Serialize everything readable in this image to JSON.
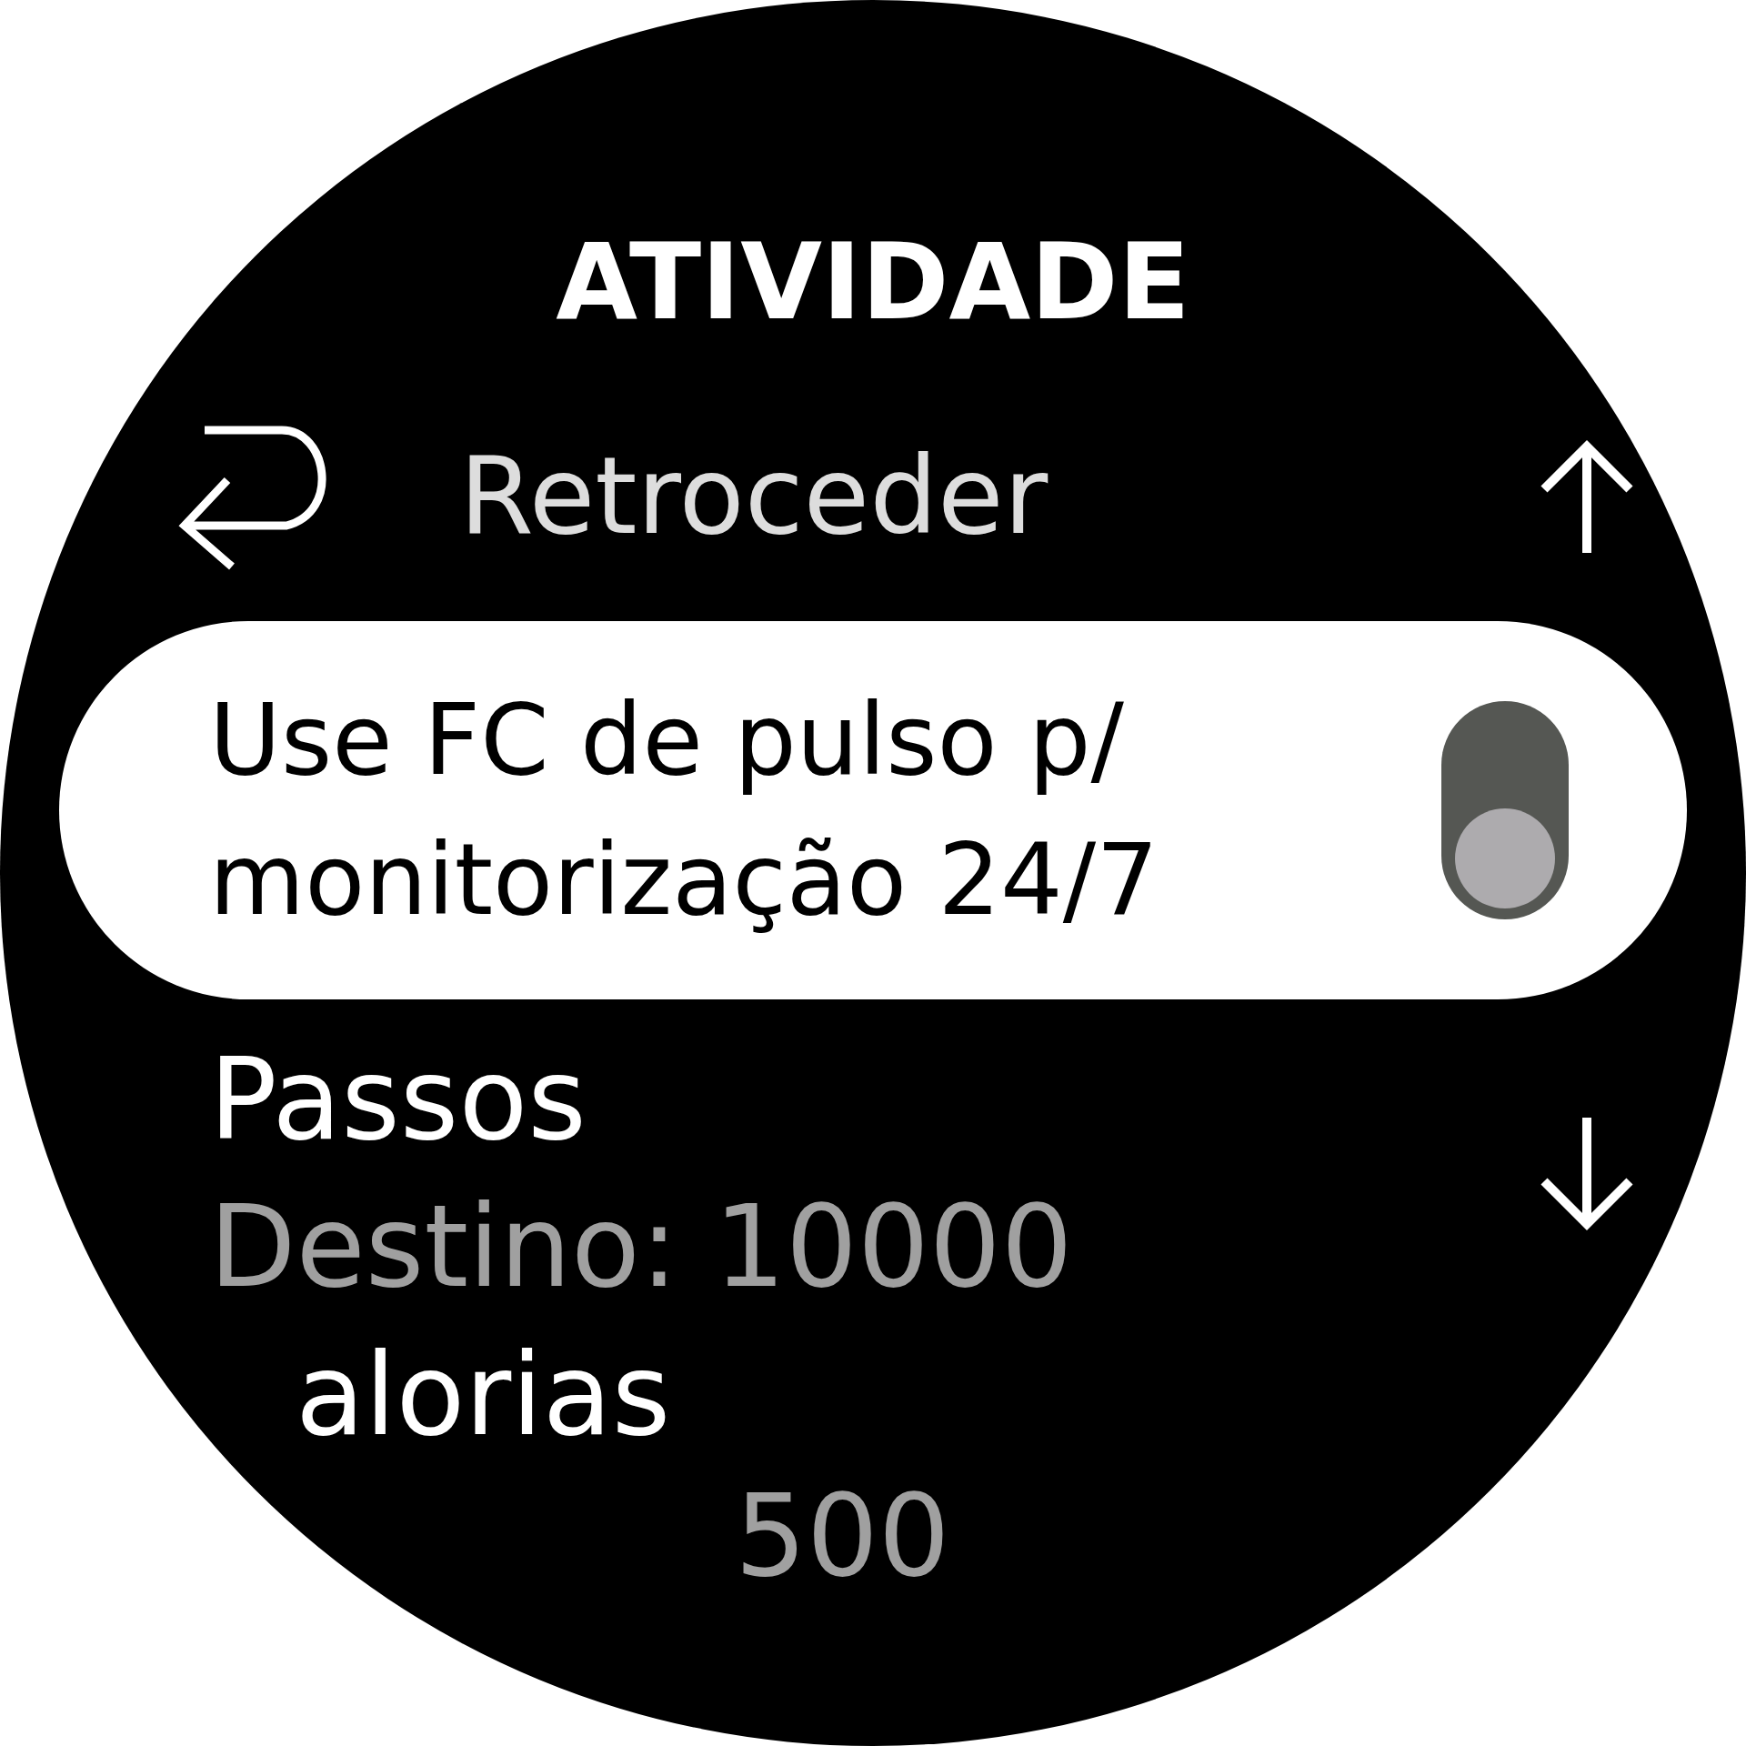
{
  "title": "ATIVIDADE",
  "back": {
    "label": "Retroceder"
  },
  "items": [
    {
      "kind": "toggle",
      "label": "Use FC de pulso p/ monitorização 24/7",
      "on": false,
      "selected": true
    },
    {
      "kind": "value",
      "label": "Passos",
      "value": "Destino: 10000",
      "selected": false
    },
    {
      "kind": "cut",
      "label": "alorias",
      "value": "500",
      "selected": false
    }
  ]
}
